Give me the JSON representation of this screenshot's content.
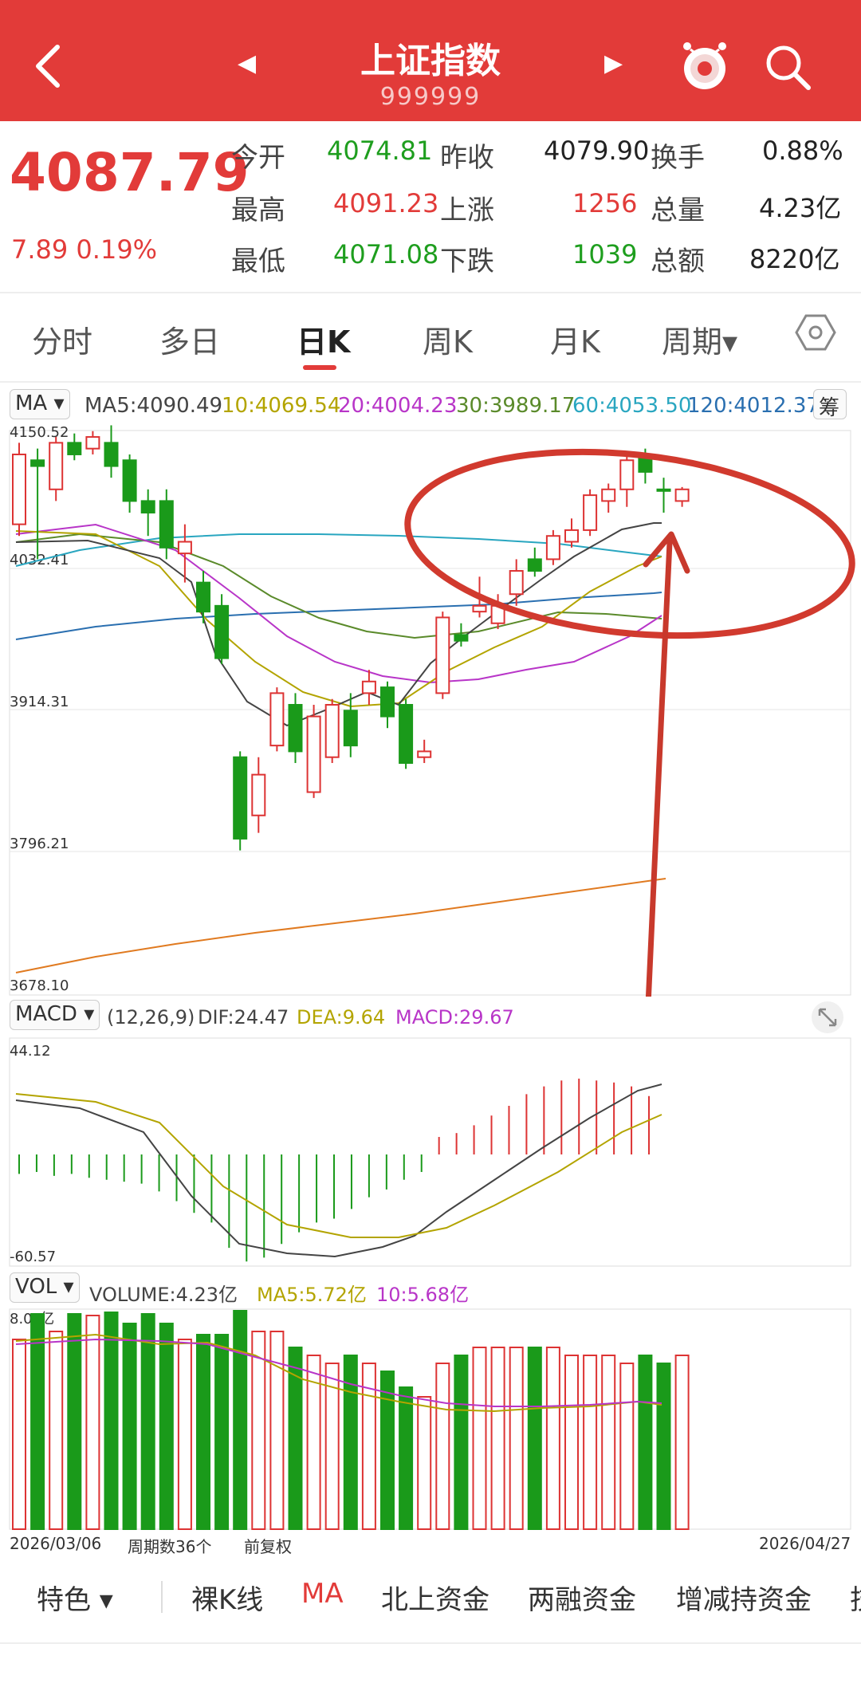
{
  "header": {
    "title": "上证指数",
    "code": "999999",
    "back_icon": "chevron-left-icon",
    "prev_icon": "triangle-left-icon",
    "next_icon": "triangle-right-icon",
    "mascot_icon": "mascot-icon",
    "search_icon": "search-icon"
  },
  "quote": {
    "price": "4087.79",
    "change": "7.89  0.19%",
    "rows": [
      [
        {
          "label": "今开",
          "value": "4074.81",
          "color": "green"
        },
        {
          "label": "昨收",
          "value": "4079.90",
          "color": "black"
        },
        {
          "label": "换手",
          "value": "0.88%",
          "color": "black"
        }
      ],
      [
        {
          "label": "最高",
          "value": "4091.23",
          "color": "red"
        },
        {
          "label": "上涨",
          "value": "1256",
          "color": "red"
        },
        {
          "label": "总量",
          "value": "4.23亿",
          "color": "black"
        }
      ],
      [
        {
          "label": "最低",
          "value": "4071.08",
          "color": "green"
        },
        {
          "label": "下跌",
          "value": "1039",
          "color": "green"
        },
        {
          "label": "总额",
          "value": "8220亿",
          "color": "black"
        }
      ]
    ]
  },
  "tabs": {
    "items": [
      "分时",
      "多日",
      "日K",
      "周K",
      "月K",
      "周期▾"
    ],
    "active": "日K",
    "settings_icon": "hexagon-gear-icon"
  },
  "ma_bar": {
    "selector": "MA",
    "ma5": "MA5:4090.49",
    "ma10": "10:4069.54",
    "ma20": "20:4004.23",
    "ma30": "30:3989.17",
    "ma60": "60:4053.50",
    "ma120": "120:4012.37",
    "trailing": "筹"
  },
  "kline": {
    "y_labels": [
      "4150.52",
      "4032.41",
      "3914.31",
      "3796.21",
      "3678.10"
    ]
  },
  "macd_bar": {
    "selector": "MACD",
    "params": "(12,26,9)",
    "dif": "DIF:24.47",
    "dea": "DEA:9.64",
    "macd": "MACD:29.67",
    "y_top": "44.12",
    "y_bottom": "-60.57",
    "expand_icon": "expand-icon"
  },
  "vol_bar": {
    "selector": "VOL",
    "volume": "VOLUME:4.23亿",
    "ma5": "MA5:5.72亿",
    "ma10": "10:5.68亿",
    "y_top": "8.0?亿"
  },
  "axis": {
    "start_date": "2026/03/06",
    "count": "周期数36个",
    "adjust": "前复权",
    "end_date": "2026/04/27"
  },
  "bottom_tabs": {
    "items": [
      "特色 ▾",
      "裸K线",
      "MA",
      "北上资金",
      "两融资金",
      "增减持资金",
      "技"
    ],
    "active": "MA"
  },
  "chart_data": {
    "type": "candlestick",
    "title": "",
    "ylim": [
      3678.1,
      4150.52
    ],
    "candles": [
      {
        "open": 4070,
        "close": 4130,
        "high": 4140,
        "low": 4060,
        "dir": "up"
      },
      {
        "open": 4125,
        "close": 4120,
        "high": 4135,
        "low": 4040,
        "dir": "down"
      },
      {
        "open": 4100,
        "close": 4140,
        "high": 4145,
        "low": 4090,
        "dir": "up"
      },
      {
        "open": 4140,
        "close": 4130,
        "high": 4148,
        "low": 4125,
        "dir": "down"
      },
      {
        "open": 4135,
        "close": 4145,
        "high": 4150,
        "low": 4130,
        "dir": "up"
      },
      {
        "open": 4140,
        "close": 4120,
        "high": 4155,
        "low": 4110,
        "dir": "down"
      },
      {
        "open": 4125,
        "close": 4090,
        "high": 4130,
        "low": 4080,
        "dir": "down"
      },
      {
        "open": 4090,
        "close": 4080,
        "high": 4100,
        "low": 4060,
        "dir": "down"
      },
      {
        "open": 4090,
        "close": 4050,
        "high": 4100,
        "low": 4040,
        "dir": "down"
      },
      {
        "open": 4045,
        "close": 4055,
        "high": 4070,
        "low": 4020,
        "dir": "up"
      },
      {
        "open": 4020,
        "close": 3995,
        "high": 4030,
        "low": 3985,
        "dir": "down"
      },
      {
        "open": 4000,
        "close": 3955,
        "high": 4010,
        "low": 3950,
        "dir": "down"
      },
      {
        "open": 3870,
        "close": 3800,
        "high": 3875,
        "low": 3790,
        "dir": "down"
      },
      {
        "open": 3820,
        "close": 3855,
        "high": 3870,
        "low": 3805,
        "dir": "up"
      },
      {
        "open": 3880,
        "close": 3925,
        "high": 3930,
        "low": 3875,
        "dir": "up"
      },
      {
        "open": 3915,
        "close": 3875,
        "high": 3925,
        "low": 3865,
        "dir": "down"
      },
      {
        "open": 3840,
        "close": 3905,
        "high": 3915,
        "low": 3835,
        "dir": "up"
      },
      {
        "open": 3870,
        "close": 3915,
        "high": 3920,
        "low": 3865,
        "dir": "up"
      },
      {
        "open": 3910,
        "close": 3880,
        "high": 3925,
        "low": 3870,
        "dir": "down"
      },
      {
        "open": 3925,
        "close": 3935,
        "high": 3945,
        "low": 3915,
        "dir": "up"
      },
      {
        "open": 3930,
        "close": 3905,
        "high": 3935,
        "low": 3895,
        "dir": "down"
      },
      {
        "open": 3915,
        "close": 3865,
        "high": 3920,
        "low": 3860,
        "dir": "down"
      },
      {
        "open": 3870,
        "close": 3875,
        "high": 3885,
        "low": 3865,
        "dir": "up"
      },
      {
        "open": 3925,
        "close": 3990,
        "high": 3995,
        "low": 3920,
        "dir": "up"
      },
      {
        "open": 3975,
        "close": 3970,
        "high": 3985,
        "low": 3965,
        "dir": "down"
      },
      {
        "open": 3995,
        "close": 4000,
        "high": 4025,
        "low": 3990,
        "dir": "up"
      },
      {
        "open": 3985,
        "close": 4000,
        "high": 4010,
        "low": 3980,
        "dir": "up"
      },
      {
        "open": 4010,
        "close": 4030,
        "high": 4040,
        "low": 4000,
        "dir": "up"
      },
      {
        "open": 4040,
        "close": 4030,
        "high": 4050,
        "low": 4025,
        "dir": "down"
      },
      {
        "open": 4040,
        "close": 4060,
        "high": 4065,
        "low": 4035,
        "dir": "up"
      },
      {
        "open": 4055,
        "close": 4065,
        "high": 4075,
        "low": 4050,
        "dir": "up"
      },
      {
        "open": 4065,
        "close": 4095,
        "high": 4100,
        "low": 4060,
        "dir": "up"
      },
      {
        "open": 4090,
        "close": 4100,
        "high": 4105,
        "low": 4080,
        "dir": "up"
      },
      {
        "open": 4100,
        "close": 4125,
        "high": 4130,
        "low": 4085,
        "dir": "up"
      },
      {
        "open": 4130,
        "close": 4115,
        "high": 4135,
        "low": 4105,
        "dir": "down"
      },
      {
        "open": 4100,
        "close": 4100,
        "high": 4110,
        "low": 4080,
        "dir": "down"
      },
      {
        "open": 4090,
        "close": 4100,
        "high": 4102,
        "low": 4085,
        "dir": "up"
      }
    ]
  }
}
